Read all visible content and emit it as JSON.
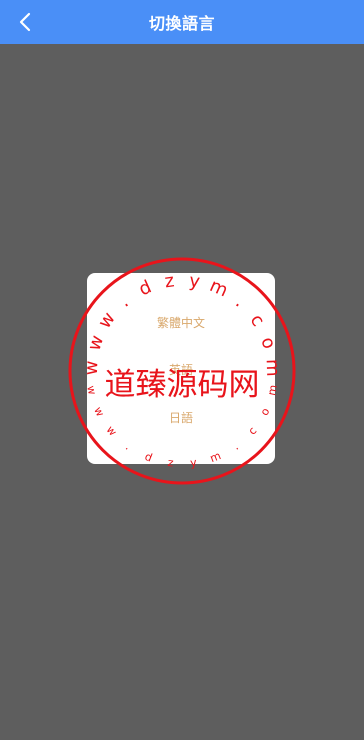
{
  "navbar": {
    "title": "切換語言",
    "back_icon": "chevron-left-icon"
  },
  "languages": [
    "繁體中文",
    "英語",
    "日語"
  ],
  "watermark": {
    "main_text": "道臻源码网",
    "ring_text": "www.dzym.com",
    "color": "#e8141b"
  },
  "colors": {
    "navbar": "#4a8ff7",
    "overlay": "#5e5e5e",
    "option_text": "#d9a86c"
  }
}
